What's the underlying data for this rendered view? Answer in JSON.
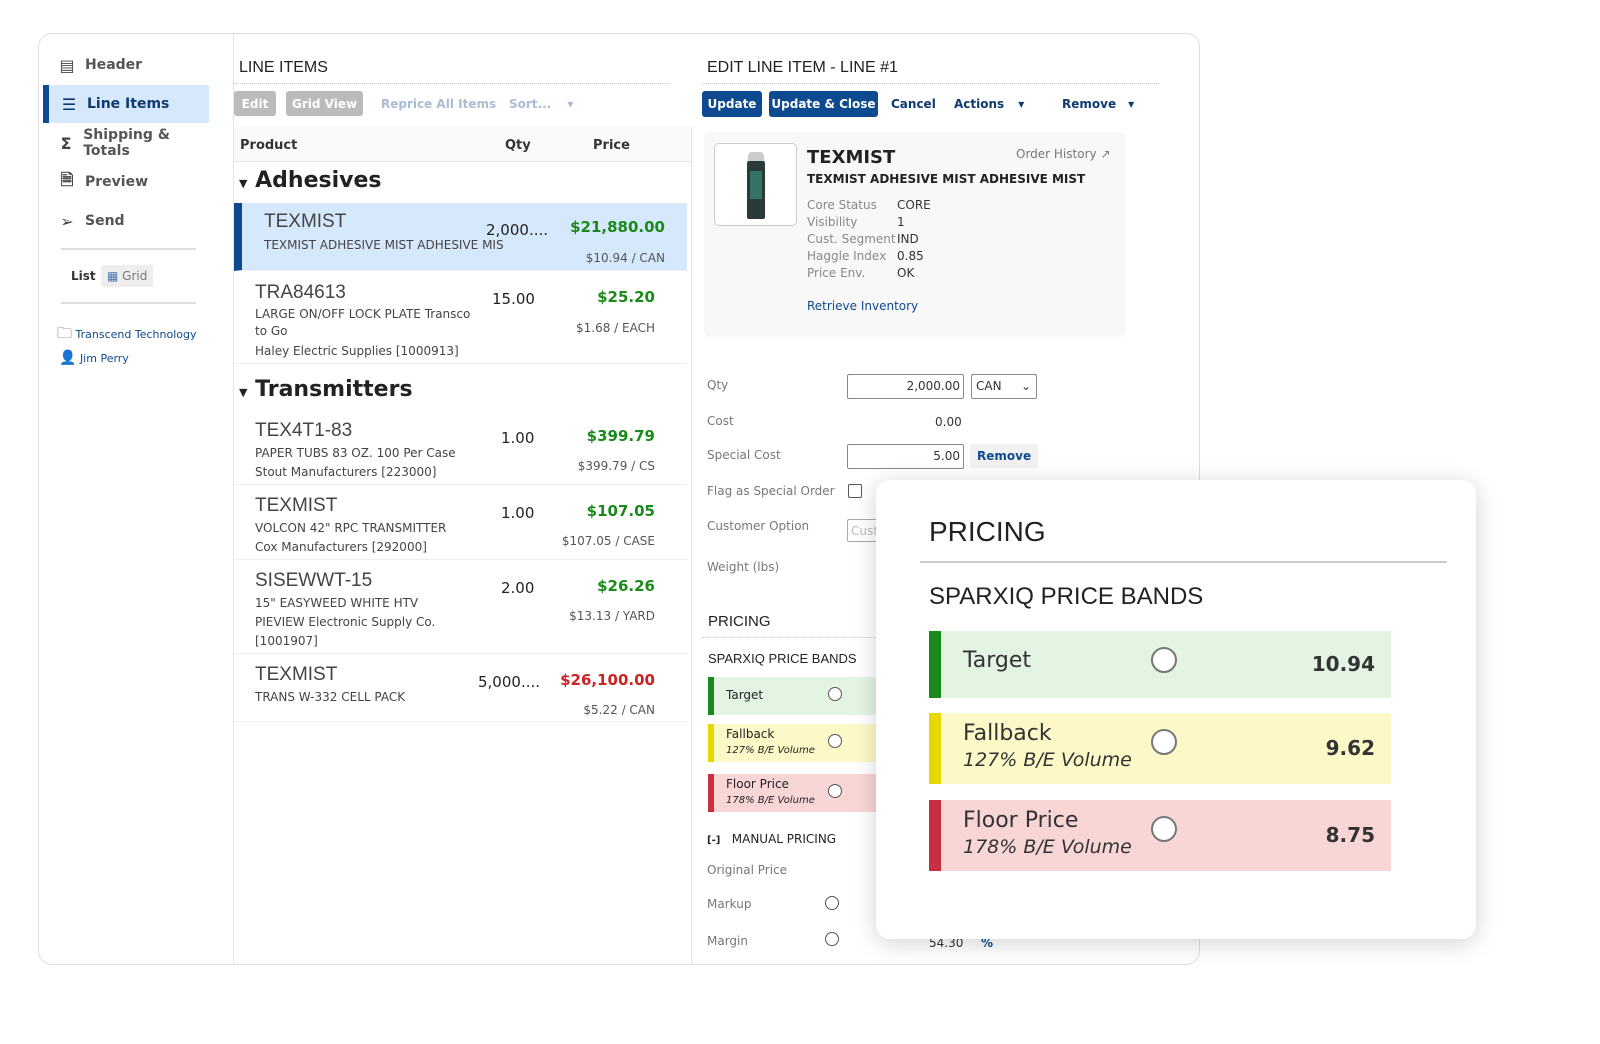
{
  "sidebar": {
    "items": [
      {
        "label": "Header",
        "icon": "newspaper-icon"
      },
      {
        "label": "Line Items",
        "icon": "list-icon",
        "active": true
      },
      {
        "label": "Shipping & Totals",
        "icon": "sigma-icon"
      },
      {
        "label": "Preview",
        "icon": "document-search-icon"
      },
      {
        "label": "Send",
        "icon": "paper-plane-icon"
      }
    ],
    "view_toggle": {
      "list": "List",
      "grid": "Grid"
    },
    "company": "Transcend Technology",
    "user": "Jim Perry"
  },
  "line_items": {
    "title": "LINE ITEMS",
    "toolbar": {
      "edit": "Edit",
      "grid_view": "Grid View",
      "reprice": "Reprice All Items",
      "sort": "Sort..."
    },
    "columns": {
      "product": "Product",
      "qty": "Qty",
      "price": "Price"
    },
    "groups": [
      {
        "name": "Adhesives",
        "rows": [
          {
            "code": "TEXMIST",
            "desc": "TEXMIST ADHESIVE MIST ADHESIVE MIS",
            "qty": "2,000....",
            "price": "$21,880.00",
            "unit": "$10.94 / CAN",
            "selected": true
          },
          {
            "code": "TRA84613",
            "desc": "LARGE ON/OFF LOCK PLATE Transco to Go",
            "supplier": "Haley Electric Supplies [1000913]",
            "qty": "15.00",
            "price": "$25.20",
            "unit": "$1.68 / EACH"
          }
        ]
      },
      {
        "name": "Transmitters",
        "rows": [
          {
            "code": "TEX4T1-83",
            "desc": "PAPER TUBS 83 OZ. 100 Per Case",
            "supplier": "Stout Manufacturers [223000]",
            "qty": "1.00",
            "price": "$399.79",
            "unit": "$399.79 / CS"
          },
          {
            "code": "TEXMIST",
            "desc": "VOLCON 42\" RPC TRANSMITTER",
            "supplier": "Cox Manufacturers [292000]",
            "qty": "1.00",
            "price": "$107.05",
            "unit": "$107.05 / CASE"
          },
          {
            "code": "SISEWWT-15",
            "desc": "15\" EASYWEED WHITE HTV",
            "supplier": "PIEVIEW Electronic Supply Co. [1001907]",
            "qty": "2.00",
            "price": "$26.26",
            "unit": "$13.13 / YARD"
          },
          {
            "code": "TEXMIST",
            "desc": "TRANS W-332 CELL PACK",
            "qty": "5,000....",
            "price": "$26,100.00",
            "unit": "$5.22 / CAN",
            "price_color": "#cc2222"
          }
        ]
      }
    ]
  },
  "edit": {
    "title": "EDIT LINE ITEM - LINE #1",
    "toolbar": {
      "update": "Update",
      "update_close": "Update & Close",
      "cancel": "Cancel",
      "actions": "Actions",
      "remove": "Remove"
    },
    "product": {
      "code": "TEXMIST",
      "name": "TEXMIST ADHESIVE MIST ADHESIVE MIST",
      "order_history": "Order History",
      "attrs": [
        {
          "k": "Core Status",
          "v": "CORE"
        },
        {
          "k": "Visibility",
          "v": "1"
        },
        {
          "k": "Cust. Segment",
          "v": "IND"
        },
        {
          "k": "Haggle Index",
          "v": "0.85"
        },
        {
          "k": "Price Env.",
          "v": "OK"
        }
      ],
      "retrieve": "Retrieve Inventory"
    },
    "fields": {
      "qty_label": "Qty",
      "qty": "2,000.00",
      "uom": "CAN",
      "cost_label": "Cost",
      "cost": "0.00",
      "special_cost_label": "Special Cost",
      "special_cost": "5.00",
      "remove": "Remove",
      "flag_label": "Flag as Special Order",
      "flag": false,
      "customer_option_label": "Customer Option",
      "customer_option_placeholder": "Cust",
      "weight_label": "Weight (lbs)"
    },
    "pricing": {
      "title": "PRICING",
      "bands_title": "SPARXIQ PRICE BANDS",
      "bands": [
        {
          "name": "Target",
          "color": "#1a8a1a",
          "bg": "#e3f4e3"
        },
        {
          "name": "Fallback",
          "sub": "127% B/E Volume",
          "color": "#e8d800",
          "bg": "#fdf8c8"
        },
        {
          "name": "Floor Price",
          "sub": "178% B/E Volume",
          "color": "#c83040",
          "bg": "#f9d6d6"
        }
      ],
      "manual_toggle": "[-]",
      "manual": "MANUAL PRICING",
      "original_price": "Original Price",
      "markup": "Markup",
      "margin": "Margin",
      "margin_value": "54.30",
      "margin_unit": "%"
    }
  },
  "overlay": {
    "title": "PRICING",
    "bands_title": "SPARXIQ PRICE BANDS",
    "bands": [
      {
        "name": "Target",
        "value": "10.94"
      },
      {
        "name": "Fallback",
        "sub": "127% B/E Volume",
        "value": "9.62"
      },
      {
        "name": "Floor Price",
        "sub": "178% B/E Volume",
        "value": "8.75"
      }
    ]
  }
}
